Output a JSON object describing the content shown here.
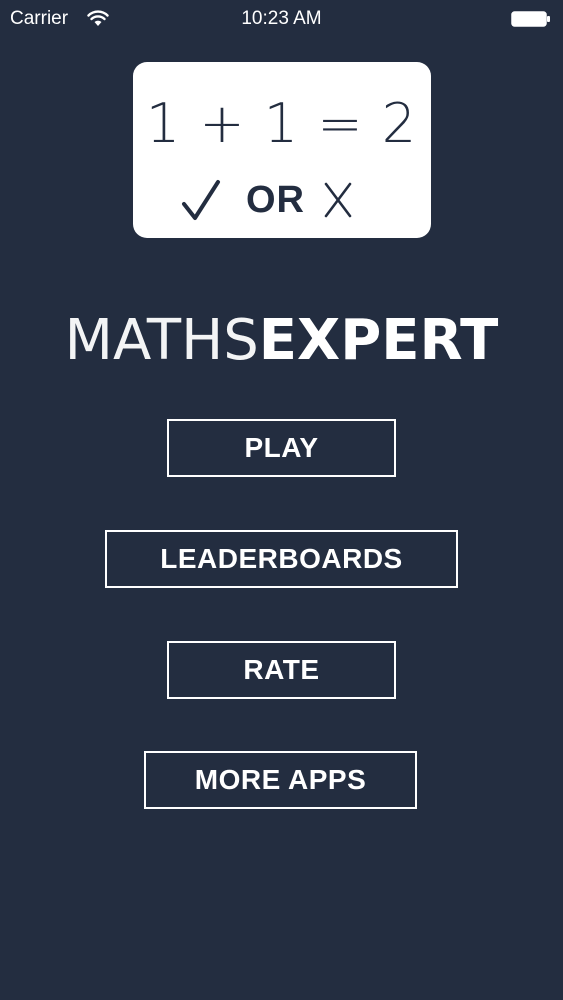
{
  "status_bar": {
    "carrier": "Carrier",
    "time": "10:23 AM",
    "wifi_icon": "wifi-icon",
    "battery_icon": "battery-icon"
  },
  "card": {
    "equation": "1 + 1 = 2",
    "check_icon": "checkmark-icon",
    "or_label": "OR",
    "x_icon": "x-icon"
  },
  "title": {
    "part1": "MATHS",
    "part2": "EXPERT"
  },
  "menu": {
    "play_label": "PLAY",
    "leaderboards_label": "LEADERBOARDS",
    "rate_label": "RATE",
    "more_apps_label": "MORE APPS"
  },
  "colors": {
    "background": "#232d40",
    "card_background": "#ffffff",
    "text": "#ffffff"
  }
}
